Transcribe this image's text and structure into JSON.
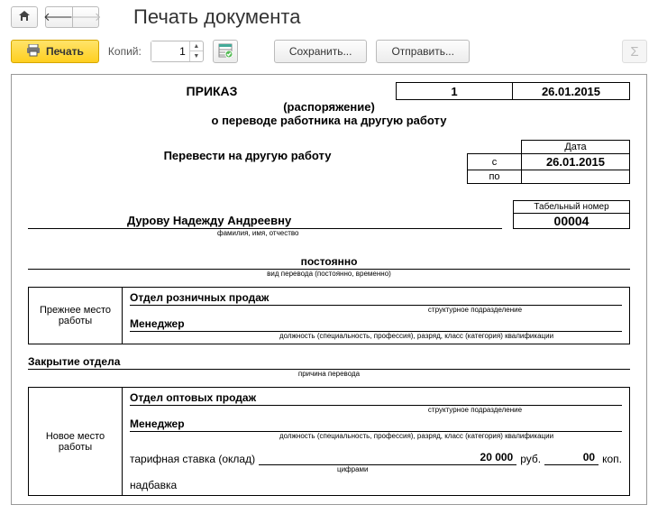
{
  "header": {
    "title": "Печать документа"
  },
  "toolbar": {
    "print_label": "Печать",
    "copies_label": "Копий:",
    "copies_value": "1",
    "save_label": "Сохранить...",
    "send_label": "Отправить..."
  },
  "doc": {
    "order_word": "ПРИКАЗ",
    "order_sub": "(распоряжение)",
    "order_about": "о переводе работника на другую работу",
    "order_number": "1",
    "order_date": "26.01.2015",
    "transfer_title": "Перевести на другую работу",
    "date_head": "Дата",
    "row_from": "с",
    "row_to": "по",
    "date_from": "26.01.2015",
    "date_to": "",
    "tab_head": "Табельный номер",
    "tab_value": "00004",
    "employee_name": "Дурову Надежду Андреевну",
    "employee_sub": "фамилия, имя, отчество",
    "perm_value": "постоянно",
    "perm_sub": "вид перевода (постоянно, временно)",
    "prev_label": "Прежнее место работы",
    "prev_dept": "Отдел розничных продаж",
    "dept_sub": "структурное подразделение",
    "prev_position": "Менеджер",
    "position_sub": "должность (специальность, профессия), разряд, класс (категория) квалификации",
    "closing_reason": "Закрытие отдела",
    "closing_sub": "причина перевода",
    "new_label": "Новое место работы",
    "new_dept": "Отдел оптовых продаж",
    "new_position": "Менеджер",
    "salary_label": "тарифная ставка (оклад)",
    "salary_rub": "20 000",
    "salary_rub_unit": "руб.",
    "salary_kop": "00",
    "salary_kop_unit": "коп.",
    "salary_sub": "цифрами",
    "bonus_label": "надбавка"
  }
}
